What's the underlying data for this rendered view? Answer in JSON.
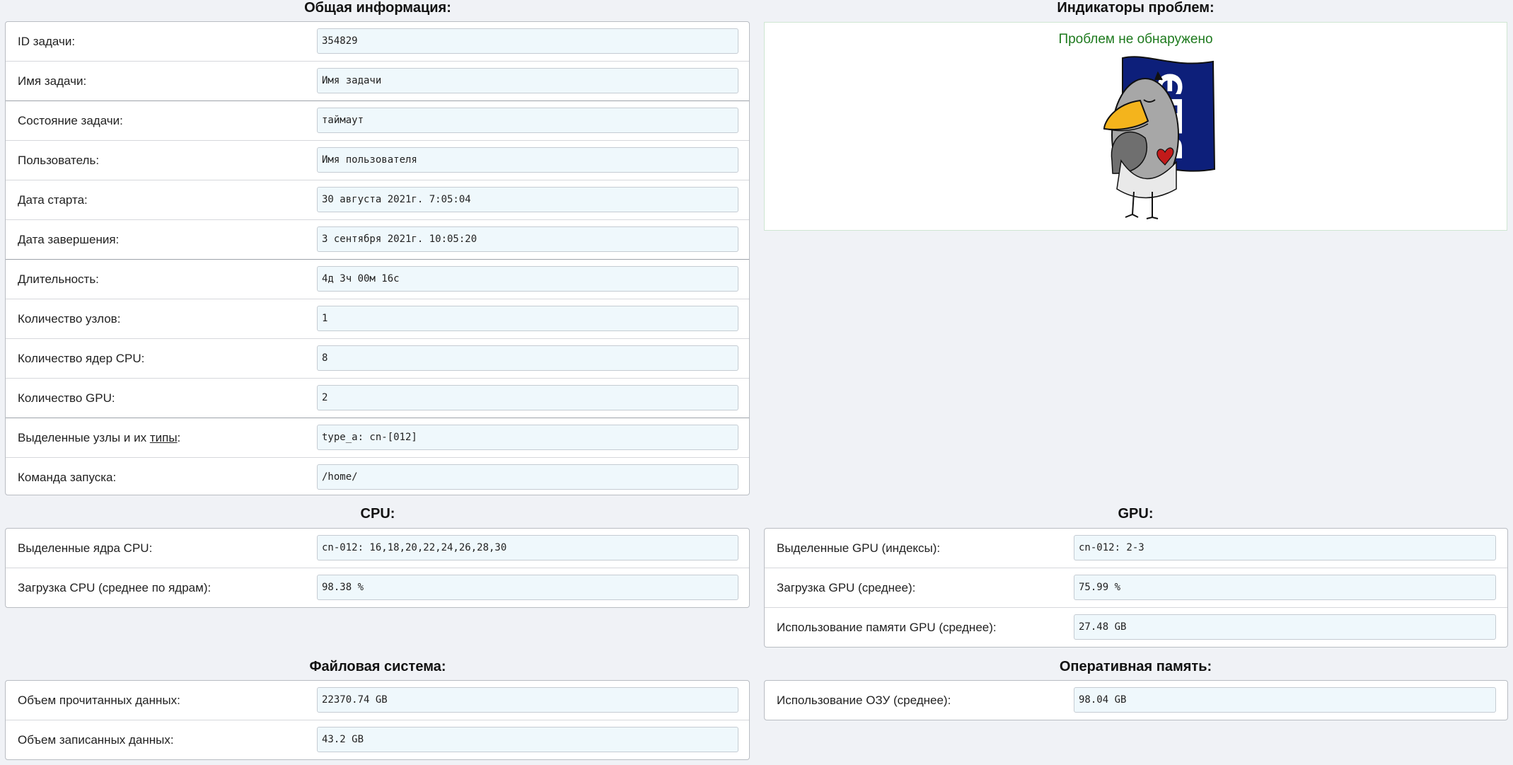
{
  "general": {
    "title": "Общая информация:",
    "rows": [
      {
        "label": "ID задачи:",
        "value": "354829"
      },
      {
        "label": "Имя задачи:",
        "value": "Имя задачи"
      },
      {
        "label": "Состояние задачи:",
        "value": "таймаут"
      },
      {
        "label": "Пользователь:",
        "value": "Имя пользователя"
      },
      {
        "label": "Дата старта:",
        "value": "30 августа 2021г. 7:05:04"
      },
      {
        "label": "Дата завершения:",
        "value": "3 сентября 2021г. 10:05:20"
      },
      {
        "label": "Длительность:",
        "value": "4д 3ч 00м 16с"
      },
      {
        "label": "Количество узлов:",
        "value": "1"
      },
      {
        "label": "Количество ядер CPU:",
        "value": "8"
      },
      {
        "label": "Количество GPU:",
        "value": "2"
      },
      {
        "label_prefix": "Выделенные узлы и их ",
        "label_link": "типы",
        "label_suffix": ":",
        "value": "type_a: cn-[012]"
      },
      {
        "label": "Команда запуска:",
        "value": "/home/"
      }
    ]
  },
  "problems": {
    "title": "Индикаторы проблем:",
    "status": "Проблем не обнаружено",
    "status_color": "#1e7a1e",
    "flag_letters": "ВШЭ"
  },
  "cpu": {
    "title": "CPU:",
    "rows": [
      {
        "label": "Выделенные ядра CPU:",
        "value": "cn-012: 16,18,20,22,24,26,28,30"
      },
      {
        "label": "Загрузка CPU (среднее по ядрам):",
        "value": "98.38 %"
      }
    ]
  },
  "gpu": {
    "title": "GPU:",
    "rows": [
      {
        "label": "Выделенные GPU (индексы):",
        "value": "cn-012: 2-3"
      },
      {
        "label": "Загрузка GPU (среднее):",
        "value": "75.99 %"
      },
      {
        "label": "Использование памяти GPU (среднее):",
        "value": "27.48 GB"
      }
    ]
  },
  "fs": {
    "title": "Файловая система:",
    "rows": [
      {
        "label": "Объем прочитанных данных:",
        "value": "22370.74 GB"
      },
      {
        "label": "Объем записанных данных:",
        "value": "43.2 GB"
      }
    ]
  },
  "ram": {
    "title": "Оперативная память:",
    "rows": [
      {
        "label": "Использование ОЗУ (среднее):",
        "value": "98.04 GB"
      }
    ]
  }
}
